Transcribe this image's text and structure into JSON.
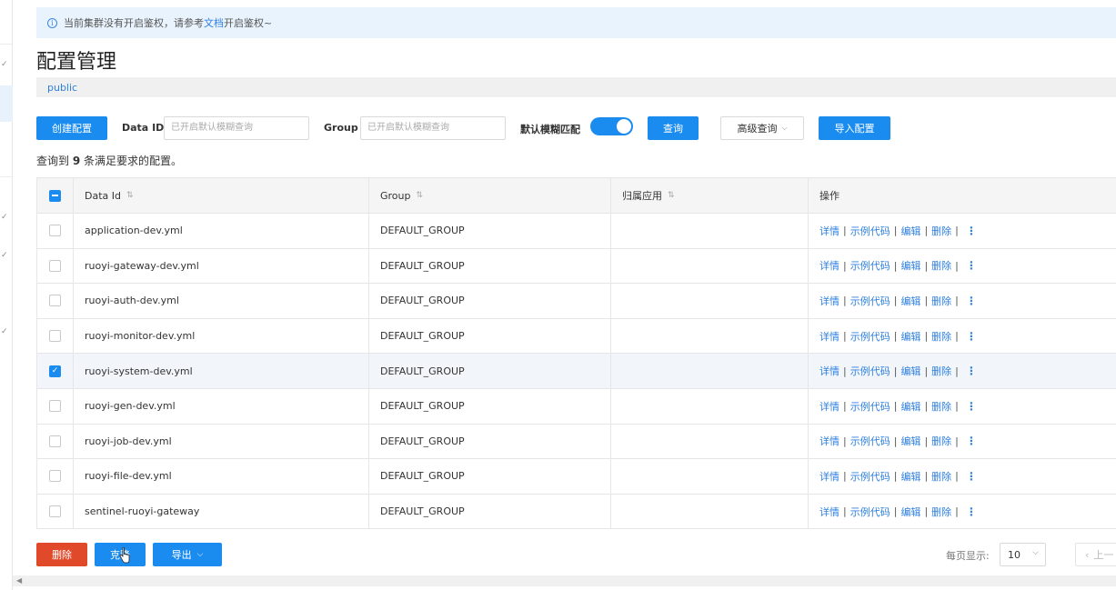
{
  "notice": {
    "prefix": "当前集群没有开启鉴权，请参考",
    "link": "文档",
    "suffix": "开启鉴权~"
  },
  "page_title": "配置管理",
  "namespace": "public",
  "toolbar": {
    "create_label": "创建配置",
    "dataid_label": "Data ID",
    "dataid_placeholder": "已开启默认模糊查询",
    "group_label": "Group",
    "group_placeholder": "已开启默认模糊查询",
    "fuzzy_label": "默认模糊匹配",
    "fuzzy_on": true,
    "query_label": "查询",
    "advanced_label": "高级查询",
    "import_label": "导入配置"
  },
  "result": {
    "prefix": "查询到",
    "count": "9",
    "suffix": "条满足要求的配置。"
  },
  "table": {
    "headers": [
      "Data Id",
      "Group",
      "归属应用",
      "操作"
    ],
    "rows": [
      {
        "data_id": "application-dev.yml",
        "group": "DEFAULT_GROUP",
        "app": "",
        "checked": false
      },
      {
        "data_id": "ruoyi-gateway-dev.yml",
        "group": "DEFAULT_GROUP",
        "app": "",
        "checked": false
      },
      {
        "data_id": "ruoyi-auth-dev.yml",
        "group": "DEFAULT_GROUP",
        "app": "",
        "checked": false
      },
      {
        "data_id": "ruoyi-monitor-dev.yml",
        "group": "DEFAULT_GROUP",
        "app": "",
        "checked": false
      },
      {
        "data_id": "ruoyi-system-dev.yml",
        "group": "DEFAULT_GROUP",
        "app": "",
        "checked": true
      },
      {
        "data_id": "ruoyi-gen-dev.yml",
        "group": "DEFAULT_GROUP",
        "app": "",
        "checked": false
      },
      {
        "data_id": "ruoyi-job-dev.yml",
        "group": "DEFAULT_GROUP",
        "app": "",
        "checked": false
      },
      {
        "data_id": "ruoyi-file-dev.yml",
        "group": "DEFAULT_GROUP",
        "app": "",
        "checked": false
      },
      {
        "data_id": "sentinel-ruoyi-gateway",
        "group": "DEFAULT_GROUP",
        "app": "",
        "checked": false
      }
    ],
    "ops": [
      "详情",
      "示例代码",
      "编辑",
      "删除"
    ],
    "sort_icon": "sort-icon",
    "more_icon": "more-vertical-icon"
  },
  "footer": {
    "delete_label": "删除",
    "clone_label": "克隆",
    "export_label": "导出",
    "page_size_label": "每页显示:",
    "page_size": "10",
    "prev_label": "上一"
  },
  "colors": {
    "primary": "#1a8cf0",
    "danger": "#e04a2a",
    "link": "#2d7fe0"
  }
}
